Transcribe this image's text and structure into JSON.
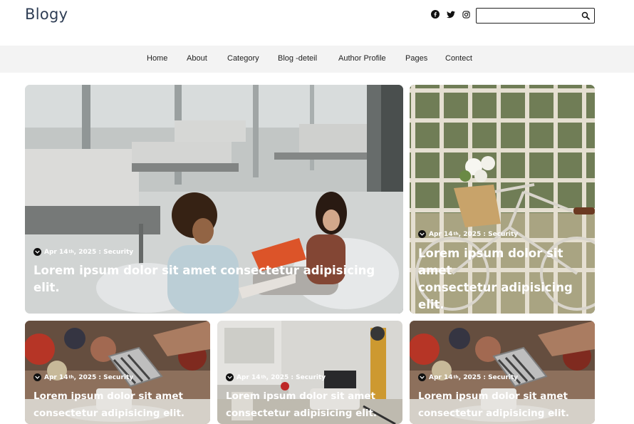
{
  "header": {
    "brand": "Blogy",
    "social": [
      "facebook-icon",
      "twitter-icon",
      "instagram-icon"
    ],
    "search": {
      "placeholder": "",
      "value": ""
    }
  },
  "nav": {
    "items": [
      "Home",
      "About",
      "Category",
      "Blog -deteil",
      "Author Profile",
      "Pages",
      "Contect"
    ]
  },
  "posts": [
    {
      "date_day": "Apr 14",
      "date_suffix": "th",
      "date_rest": ", 2025 : Security",
      "title": "Lorem ipsum dolor sit amet consectetur adipisicing elit."
    },
    {
      "date_day": "Apr 14",
      "date_suffix": "th",
      "date_rest": ", 2025 : Security",
      "title_line1": "Lorem ipsum dolor sit amet",
      "title_line2": "consectetur adipisicing elit."
    },
    {
      "date_day": "Apr 14",
      "date_suffix": "th",
      "date_rest": ", 2025 : Security",
      "title_line1": "Lorem ipsum dolor sit amet",
      "title_line2": "consectetur adipisicing elit."
    },
    {
      "date_day": "Apr 14",
      "date_suffix": "th",
      "date_rest": ", 2025 : Security",
      "title_line1": "Lorem ipsum dolor sit amet",
      "title_line2": "consectetur adipisicing elit."
    },
    {
      "date_day": "Apr 14",
      "date_suffix": "th",
      "date_rest": ", 2025 : Security",
      "title_line1": "Lorem ipsum dolor sit amet",
      "title_line2": "consectetur adipisicing elit."
    }
  ],
  "colors": {
    "nav_bg": "#f3f3f3",
    "brand": "#2f3e55",
    "text_on_image": "#ffffff"
  }
}
